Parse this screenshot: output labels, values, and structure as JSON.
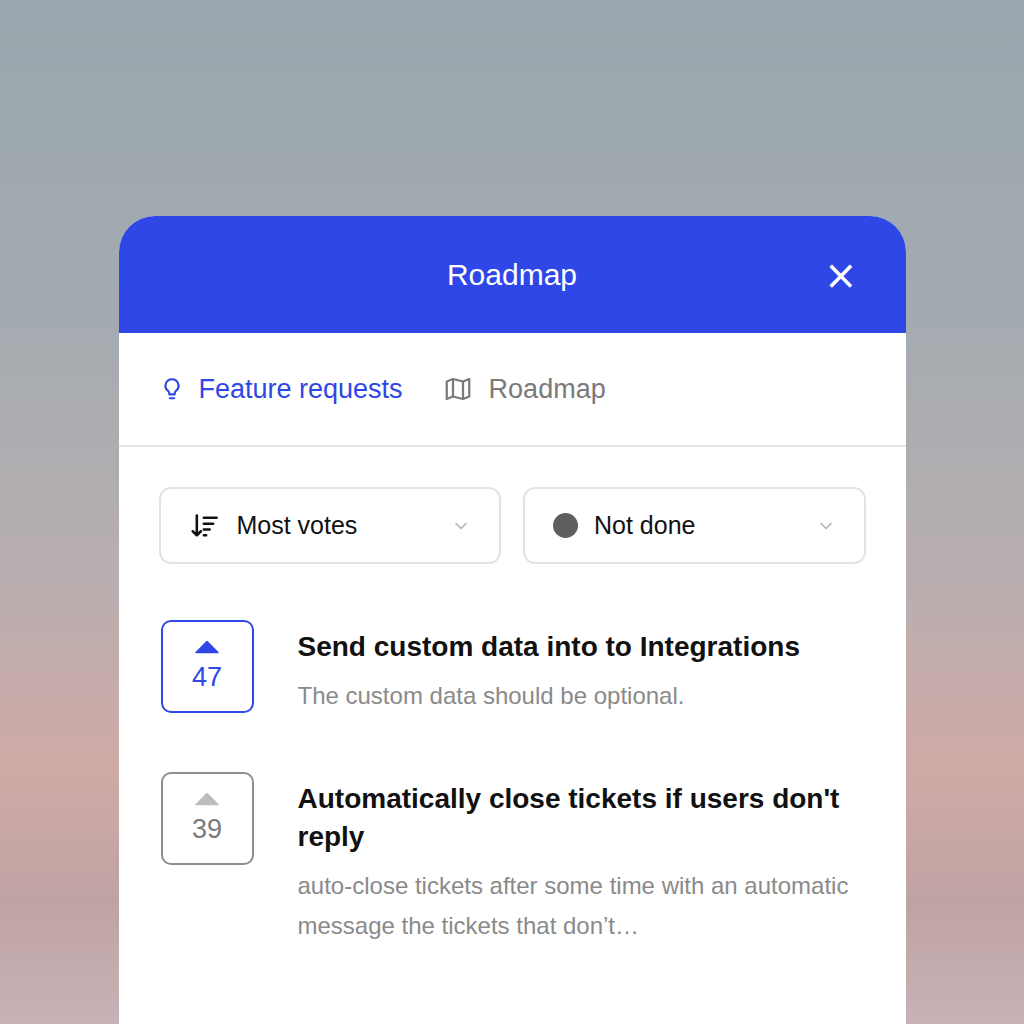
{
  "header": {
    "title": "Roadmap",
    "close": "×"
  },
  "tabs": [
    {
      "label": "Feature requests",
      "selected": true
    },
    {
      "label": "Roadmap",
      "selected": false
    }
  ],
  "filters": {
    "sort": "Most votes",
    "status": {
      "label": "Not done",
      "color": "#5f5f5f"
    }
  },
  "requests": [
    {
      "votes": "47",
      "voted": true,
      "title": "Send custom data into to Integrations",
      "description": "The custom data should be optional."
    },
    {
      "votes": "39",
      "voted": false,
      "title": "Automatically close tickets if users don't reply",
      "description": "auto-close tickets after some time with an automatic message the tickets that don’t…"
    }
  ]
}
